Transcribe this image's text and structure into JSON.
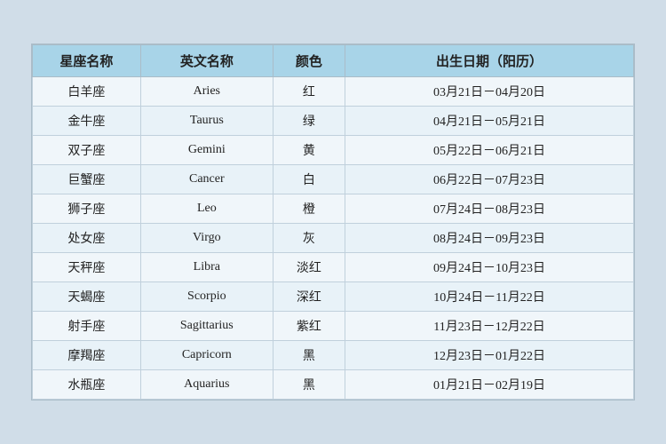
{
  "table": {
    "headers": [
      {
        "key": "cn_name",
        "label": "星座名称"
      },
      {
        "key": "en_name",
        "label": "英文名称"
      },
      {
        "key": "color",
        "label": "颜色"
      },
      {
        "key": "date_range",
        "label": "出生日期（阳历）"
      }
    ],
    "rows": [
      {
        "cn_name": "白羊座",
        "en_name": "Aries",
        "color": "红",
        "date_range": "03月21日－04月20日"
      },
      {
        "cn_name": "金牛座",
        "en_name": "Taurus",
        "color": "绿",
        "date_range": "04月21日－05月21日"
      },
      {
        "cn_name": "双子座",
        "en_name": "Gemini",
        "color": "黄",
        "date_range": "05月22日－06月21日"
      },
      {
        "cn_name": "巨蟹座",
        "en_name": "Cancer",
        "color": "白",
        "date_range": "06月22日－07月23日"
      },
      {
        "cn_name": "狮子座",
        "en_name": "Leo",
        "color": "橙",
        "date_range": "07月24日－08月23日"
      },
      {
        "cn_name": "处女座",
        "en_name": "Virgo",
        "color": "灰",
        "date_range": "08月24日－09月23日"
      },
      {
        "cn_name": "天秤座",
        "en_name": "Libra",
        "color": "淡红",
        "date_range": "09月24日－10月23日"
      },
      {
        "cn_name": "天蝎座",
        "en_name": "Scorpio",
        "color": "深红",
        "date_range": "10月24日－11月22日"
      },
      {
        "cn_name": "射手座",
        "en_name": "Sagittarius",
        "color": "紫红",
        "date_range": "11月23日－12月22日"
      },
      {
        "cn_name": "摩羯座",
        "en_name": "Capricorn",
        "color": "黑",
        "date_range": "12月23日－01月22日"
      },
      {
        "cn_name": "水瓶座",
        "en_name": "Aquarius",
        "color": "黑",
        "date_range": "01月21日－02月19日"
      }
    ]
  }
}
